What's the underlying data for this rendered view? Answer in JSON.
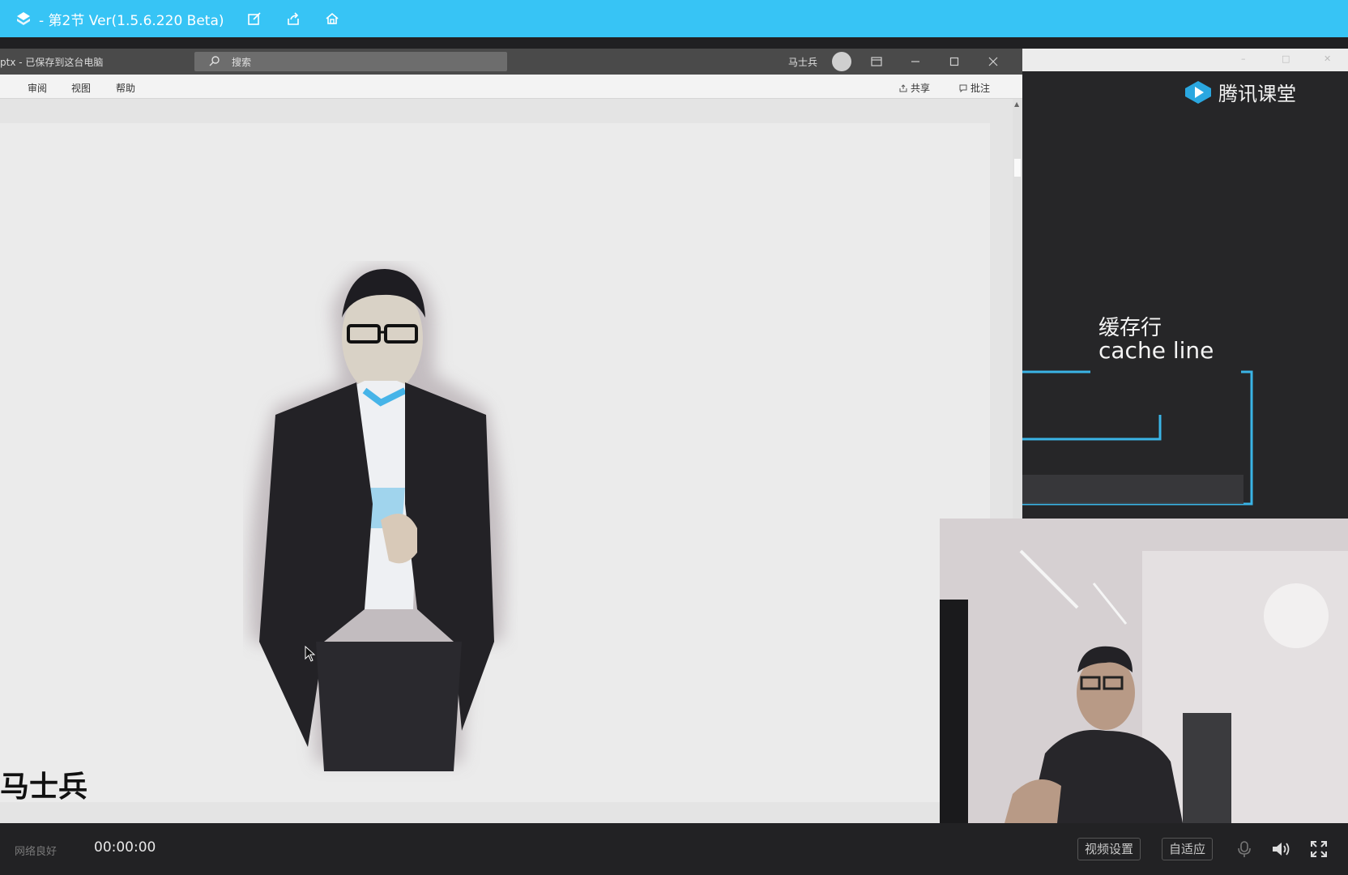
{
  "player": {
    "title": "- 第2节 Ver(1.5.6.220 Beta)",
    "icons": [
      "app-logo-icon",
      "edit-icon",
      "share-icon",
      "home-icon"
    ]
  },
  "ppt": {
    "file_name": "ptx - 已保存到这台电脑",
    "search_label": "搜索",
    "user_name": "马士兵",
    "ribbon_tabs": [
      "审阅",
      "视图",
      "帮助"
    ],
    "share_label": "共享",
    "comment_label": "批注",
    "slide_name": "马士兵"
  },
  "panel": {
    "brand": "腾讯课堂",
    "cache_line_cn": "缓存行",
    "cache_line_en": "cache line"
  },
  "controls": {
    "network_status": "网络良好",
    "time": "00:00:00",
    "video_settings": "视频设置",
    "fit_label": "自适应",
    "icons": [
      "microphone-icon",
      "volume-icon",
      "fullscreen-icon"
    ]
  },
  "colors": {
    "player_bar": "#37c4f5",
    "panel_bg": "#262628",
    "diagram_line": "#3ab4e6"
  }
}
